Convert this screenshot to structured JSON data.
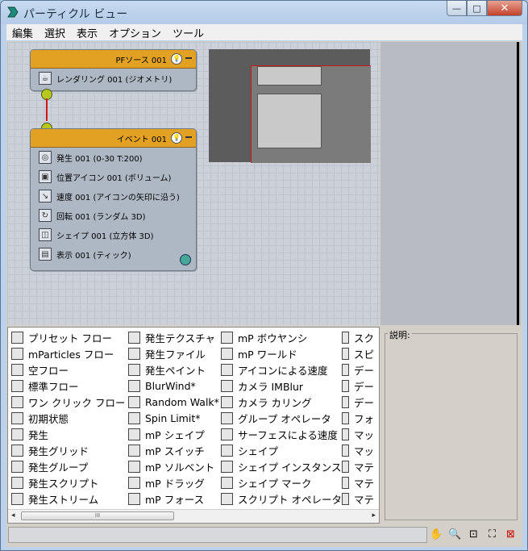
{
  "window": {
    "title": "パーティクル ビュー",
    "min_label": "—",
    "max_label": "□",
    "close_label": "✕"
  },
  "menu": [
    "編集",
    "選択",
    "表示",
    "オプション",
    "ツール"
  ],
  "nodes": {
    "source": {
      "title": "PFソース 001",
      "ops": [
        "レンダリング 001 (ジオメトリ)"
      ]
    },
    "event": {
      "title": "イベント 001",
      "ops": [
        "発生 001 (0-30 T:200)",
        "位置アイコン 001 (ボリューム)",
        "速度 001 (アイコンの矢印に沿う)",
        "回転 001 (ランダム 3D)",
        "シェイプ 001 (立方体 3D)",
        "表示 001 (ティック)"
      ]
    }
  },
  "depot": {
    "columns": [
      [
        "プリセット フロー",
        "mParticles フロー",
        "空フロー",
        "標準フロー",
        "ワン クリック フロー",
        "初期状態",
        "発生",
        "発生グリッド",
        "発生グループ",
        "発生スクリプト",
        "発生ストリーム"
      ],
      [
        "発生テクスチャ",
        "発生ファイル",
        "発生ペイント",
        "BlurWind*",
        "Random Walk*",
        "Spin Limit*",
        "mP シェイプ",
        "mP スイッチ",
        "mP ソルベント",
        "mP ドラッグ",
        "mP フォース"
      ],
      [
        "mP ボウヤンシ",
        "mP ワールド",
        "アイコンによる速度",
        "カメラ IMBlur",
        "カメラ カリング",
        "グループ オペレータ",
        "サーフェスによる速度",
        "シェイプ",
        "シェイプ インスタンス",
        "シェイプ マーク",
        "スクリプト オペレータ"
      ],
      [
        "スク",
        "スピ",
        "デー",
        "デー",
        "デー",
        "フォ",
        "マッ",
        "マッ",
        "マテ",
        "マテ",
        "マテ"
      ]
    ],
    "scroll_left": "◂",
    "scroll_right": "▸",
    "thumb_grip": "III"
  },
  "description": {
    "label": "説明:"
  },
  "colors": {
    "node_header": "#e3a123",
    "wire": "#d01515",
    "port": "#b6c81e"
  }
}
